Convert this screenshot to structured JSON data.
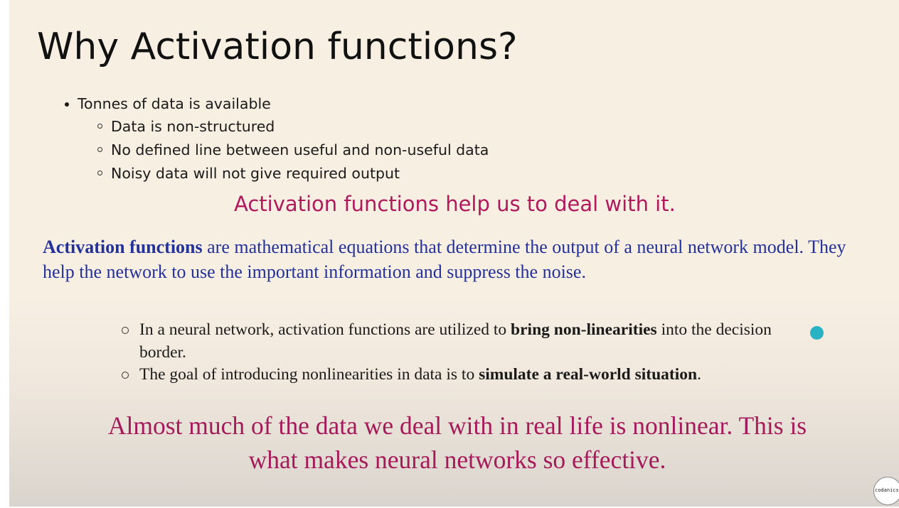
{
  "slide": {
    "title": "Why Activation functions?",
    "bullet": "Tonnes of data is available",
    "sub_bullets": [
      "Data is non-structured",
      "No defined line between useful and non-useful data",
      "Noisy data will not give required output"
    ],
    "callout_top": "Activation functions help us to deal with it.",
    "definition": {
      "term": "Activation functions",
      "text": " are mathematical equations that determine the output of a neural network model. They help the network to use the important information and suppress the noise."
    },
    "points": [
      {
        "before": "In a neural network, activation functions are utilized to ",
        "bold": "bring non-linearities",
        "after": " into the decision border."
      },
      {
        "before": "The goal of introducing nonlinearities in data is to ",
        "bold": "simulate a real-world situation",
        "after": "."
      }
    ],
    "callout_bottom": "Almost much of the data we deal with in real life is nonlinear. This is what makes neural networks so effective.",
    "logo_text": "codanics"
  },
  "colors": {
    "background": "#f8efe3",
    "callout": "#b01a5c",
    "definition": "#23329a",
    "cursor": "#27b3c4"
  }
}
